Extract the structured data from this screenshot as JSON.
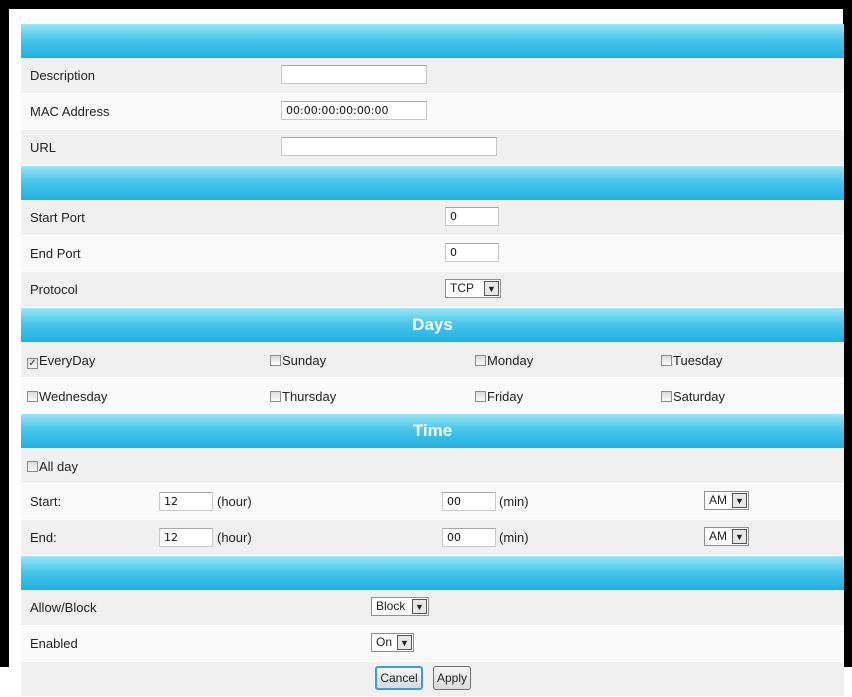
{
  "address": {
    "description_label": "Description",
    "description_value": "",
    "mac_label": "MAC Address",
    "mac_value": "00:00:00:00:00:00",
    "url_label": "URL",
    "url_value": ""
  },
  "ports": {
    "start_label": "Start Port",
    "start_value": "0",
    "end_label": "End Port",
    "end_value": "0",
    "protocol_label": "Protocol",
    "protocol_value": "TCP"
  },
  "days": {
    "title": "Days",
    "items": [
      {
        "label": "EveryDay",
        "checked": true
      },
      {
        "label": "Sunday",
        "checked": false
      },
      {
        "label": "Monday",
        "checked": false
      },
      {
        "label": "Tuesday",
        "checked": false
      },
      {
        "label": "Wednesday",
        "checked": false
      },
      {
        "label": "Thursday",
        "checked": false
      },
      {
        "label": "Friday",
        "checked": false
      },
      {
        "label": "Saturday",
        "checked": false
      }
    ]
  },
  "time": {
    "title": "Time",
    "allday_label": "All day",
    "allday_checked": false,
    "start_label": "Start:",
    "start_hour": "12",
    "start_min": "00",
    "start_ampm": "AM",
    "end_label": "End:",
    "end_hour": "12",
    "end_min": "00",
    "end_ampm": "AM",
    "hour_unit": "(hour)",
    "min_unit": "(min)"
  },
  "rule": {
    "allow_block_label": "Allow/Block",
    "allow_block_value": "Block",
    "enabled_label": "Enabled",
    "enabled_value": "On"
  },
  "buttons": {
    "cancel": "Cancel",
    "apply": "Apply"
  },
  "icons": {
    "dropdown": "▼",
    "checkmark": "✓"
  },
  "colors": {
    "band_top": "#9be6f6",
    "band_bottom": "#1fb1e2",
    "row_light": "#fafafa",
    "row_dark": "#f0f0f0"
  }
}
